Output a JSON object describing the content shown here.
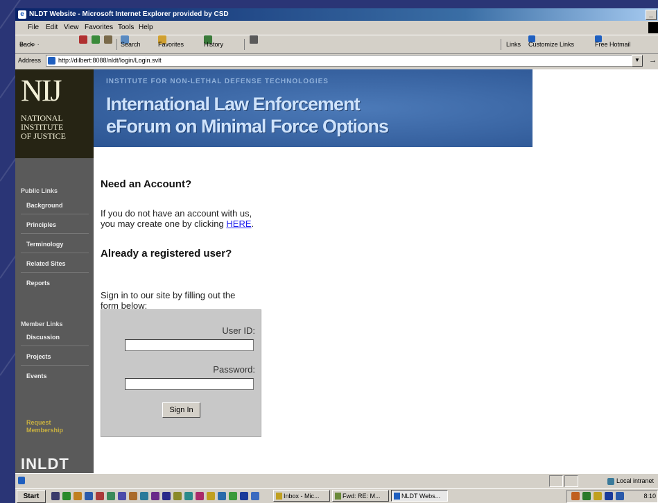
{
  "window": {
    "title": "NLDT Website - Microsoft Internet Explorer provided by CSD",
    "minimize_glyph": "_"
  },
  "menu": [
    "File",
    "Edit",
    "View",
    "Favorites",
    "Tools",
    "Help"
  ],
  "toolbar": {
    "back": "Back",
    "back_arrows": "⇦ · ⇨ ·",
    "search": "Search",
    "favorites": "Favorites",
    "history": "History",
    "links": "Links",
    "customize_links": "Customize Links",
    "free_hotmail": "Free Hotmail"
  },
  "address": {
    "label": "Address",
    "url": "http://dilbert:8088/nldt/login/Login.svlt",
    "go_glyph": "→"
  },
  "sidebar": {
    "logo_big": "NIJ",
    "logo_small": [
      "NATIONAL",
      "INSTITUTE",
      "OF JUSTICE"
    ],
    "public_heading": "Public Links",
    "public_links": [
      "Background",
      "Principles",
      "Terminology",
      "Related Sites",
      "Reports"
    ],
    "member_heading": "Member Links",
    "member_links": [
      "Discussion",
      "Projects",
      "Events"
    ],
    "request": "Request Membership",
    "bottom_logo": "INLDT"
  },
  "banner": {
    "institute": "INSTITUTE FOR NON-LETHAL DEFENSE TECHNOLOGIES",
    "line1": "International Law Enforcement",
    "line2": "eForum on Minimal Force Options"
  },
  "content": {
    "need_account_heading": "Need an Account?",
    "need_account_text": "If you do not have an account with us, you may create one by clicking",
    "here_link": "HERE",
    "registered_heading": "Already a registered user?",
    "sign_in_text": "Sign in to our site by filling out the form below:",
    "user_id_label": "User ID:",
    "password_label": "Password:",
    "sign_in_button": "Sign In"
  },
  "status": {
    "zone": "Local intranet"
  },
  "taskbar": {
    "start": "Start",
    "tasks": [
      "Inbox - Mic...",
      "Fwd: RE: M...",
      "NLDT Webs..."
    ],
    "clock": "8:10"
  }
}
